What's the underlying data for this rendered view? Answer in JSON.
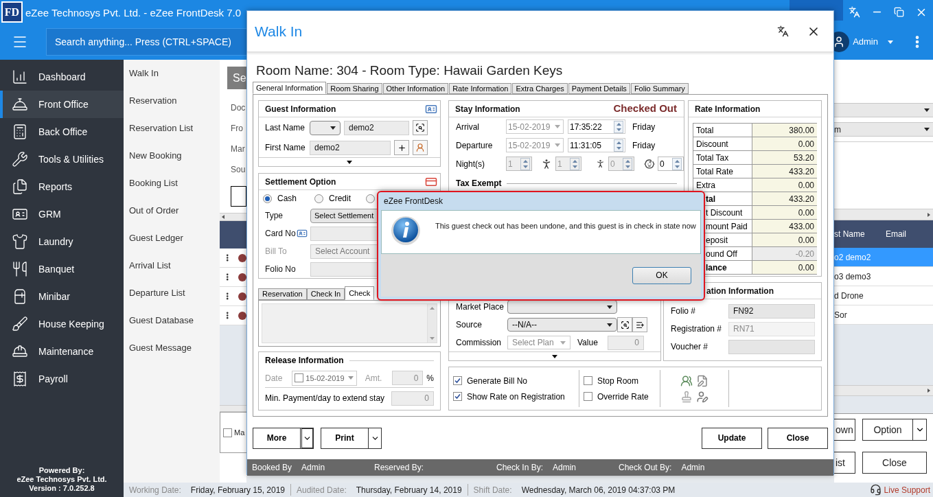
{
  "app": {
    "logo": "FD",
    "title": "eZee Technosys Pvt. Ltd. - eZee FrontDesk 7.0"
  },
  "search": {
    "placeholder": "Search anything... Press (CTRL+SPACE)"
  },
  "user": {
    "name": "Admin"
  },
  "sidebar": {
    "items": [
      {
        "label": "Dashboard",
        "selected": false
      },
      {
        "label": "Front Office",
        "selected": true
      },
      {
        "label": "Back Office",
        "selected": false
      },
      {
        "label": "Tools & Utilities",
        "selected": false
      },
      {
        "label": "Reports",
        "selected": false
      },
      {
        "label": "GRM",
        "selected": false
      },
      {
        "label": "Laundry",
        "selected": false
      },
      {
        "label": "Banquet",
        "selected": false
      },
      {
        "label": "Minibar",
        "selected": false
      },
      {
        "label": "House Keeping",
        "selected": false
      },
      {
        "label": "Maintenance",
        "selected": false
      },
      {
        "label": "Payroll",
        "selected": false
      }
    ],
    "footer": [
      "Powered By:",
      "eZee Technosys Pvt. Ltd.",
      "Version : 7.0.252.8"
    ]
  },
  "submenu": {
    "items": [
      "Walk In",
      "Reservation",
      "Reservation List",
      "New Booking",
      "Booking List",
      "Out of Order",
      "Guest Ledger",
      "Arrival List",
      "Departure List",
      "Guest Database",
      "Guest Message"
    ]
  },
  "background": {
    "left": {
      "button": "Se",
      "labels": [
        "Doc",
        "Fro",
        "Mar",
        "Sou"
      ],
      "checkbox": {
        "label": "Ma",
        "checked": false
      }
    },
    "right": {
      "dropdowns": [
        {
          "kind": "select"
        },
        {
          "kind": "select",
          "value": "m"
        }
      ],
      "columns": [
        "st Name",
        "Email"
      ],
      "rows": [
        {
          "cell": "o2 demo2",
          "selected": true
        },
        {
          "cell": "o3 demo3",
          "selected": false
        },
        {
          "cell": "d Drone",
          "selected": false
        },
        {
          "cell": "Sor",
          "selected": false
        }
      ],
      "button_rows": [
        [
          {
            "label": "own",
            "kind": "plain"
          },
          {
            "label": "Option",
            "kind": "split"
          }
        ],
        [
          {
            "label": "ist",
            "kind": "plain"
          },
          {
            "label": "Close",
            "kind": "plain"
          }
        ]
      ]
    }
  },
  "walk_in": {
    "title": "Walk In",
    "heading": "Room Name: 304 - Room Type: Hawaii Garden Keys",
    "tabs": [
      {
        "label": "General Information",
        "selected": true
      },
      {
        "label": "Room Sharing",
        "selected": false
      },
      {
        "label": "Other Information",
        "selected": false
      },
      {
        "label": "Rate Information",
        "selected": false
      },
      {
        "label": "Extra Charges",
        "selected": false
      },
      {
        "label": "Payment Details",
        "selected": false
      },
      {
        "label": "Folio Summary",
        "selected": false
      }
    ],
    "guest": {
      "title": "Guest Information",
      "last_name_label": "Last Name",
      "last_name": "demo2",
      "first_name_label": "First Name",
      "first_name": "demo2"
    },
    "settlement": {
      "title": "Settlement Option",
      "options": [
        {
          "label": "Cash",
          "selected": true
        },
        {
          "label": "Credit",
          "selected": false
        },
        {
          "selected": false
        }
      ],
      "fields": [
        {
          "label": "Type",
          "kind": "button",
          "value": "Select Settlement",
          "disabled": false
        },
        {
          "label": "Card No",
          "kind": "card",
          "disabled": false
        },
        {
          "label": "Bill To",
          "kind": "select",
          "value": "Select Account",
          "disabled": true
        },
        {
          "label": "Folio No",
          "kind": "text",
          "disabled": false
        }
      ]
    },
    "note_tabs": [
      {
        "label": "Reservation",
        "selected": false
      },
      {
        "label": "Check In",
        "selected": false
      },
      {
        "label": "Check",
        "selected": true
      }
    ],
    "release": {
      "title": "Release Information",
      "date_label": "Date",
      "date_checked": false,
      "date": "15-02-2019",
      "amount_label": "Amt.",
      "amount": "0",
      "percent": "%",
      "min_payment_label": "Min. Payment/day to extend stay",
      "min_payment": "0"
    },
    "stay": {
      "title": "Stay Information",
      "status": "Checked Out",
      "dates": [
        {
          "label": "Arrival",
          "date": "15-02-2019",
          "time": "17:35:22",
          "day": "Friday"
        },
        {
          "label": "Departure",
          "date": "15-02-2019",
          "time": "11:31:05",
          "day": "Friday"
        }
      ],
      "nights_label": "Night(s)",
      "nights": "1",
      "adults": "1",
      "children": "0",
      "infants": "0",
      "tax_exempt": "Tax Exempt",
      "market_place_label": "Market Place",
      "source_label": "Source",
      "source": "--N/A--",
      "commission_label": "Commission",
      "commission": "Select Plan",
      "value_label": "Value",
      "value": "0"
    },
    "rate": {
      "title": "Rate Information",
      "rows": [
        {
          "label": "Total",
          "value": "380.00",
          "bold": false,
          "covered": false,
          "disabled": false
        },
        {
          "label": "Discount",
          "value": "0.00",
          "bold": false,
          "covered": false,
          "disabled": false
        },
        {
          "label": "Total Tax",
          "value": "53.20",
          "bold": false,
          "covered": false,
          "disabled": false
        },
        {
          "label": "Total Rate",
          "value": "433.20",
          "bold": false,
          "covered": false,
          "disabled": false
        },
        {
          "label": "Extra",
          "value": "0.00",
          "bold": false,
          "covered": false,
          "disabled": false
        },
        {
          "label": "tal",
          "value": "433.20",
          "bold": true,
          "covered": true,
          "disabled": false
        },
        {
          "label": "t Discount",
          "value": "0.00",
          "bold": false,
          "covered": true,
          "disabled": false
        },
        {
          "label": "mount Paid",
          "value": "433.00",
          "bold": false,
          "covered": true,
          "disabled": false
        },
        {
          "label": "eposit",
          "value": "0.00",
          "bold": false,
          "covered": true,
          "disabled": false
        },
        {
          "label": "ound Off",
          "value": "-0.20",
          "bold": false,
          "covered": true,
          "disabled": true
        },
        {
          "label": "lance",
          "value": "0.00",
          "bold": true,
          "covered": true,
          "disabled": false
        }
      ]
    },
    "reservation": {
      "title": "ation Information",
      "fields": [
        {
          "label": "Folio #",
          "value": "FN92",
          "disabled": false
        },
        {
          "label": "Registration #",
          "value": "RN71",
          "disabled": true
        },
        {
          "label": "Voucher #",
          "disabled": false
        }
      ]
    },
    "option_groups": [
      [
        {
          "label": "Generate Bill No",
          "checked": true
        },
        {
          "label": "Show Rate on Registration",
          "checked": true
        }
      ],
      [
        {
          "label": "Stop Room",
          "checked": false
        },
        {
          "label": "Override Rate",
          "checked": false
        }
      ]
    ],
    "left_buttons": [
      "More",
      "Print"
    ],
    "right_buttons": [
      "Update",
      "Close"
    ],
    "audit": [
      {
        "label": "Booked By",
        "value": "Admin"
      },
      {
        "label": "Reserved By:"
      },
      {
        "label": "Check In By:",
        "value": "Admin"
      },
      {
        "label": "Check Out By:",
        "value": "Admin"
      }
    ]
  },
  "message_box": {
    "title": "eZee FrontDesk",
    "message": "This guest check out has been undone, and this guest is in check in state now",
    "button": "OK"
  },
  "status_bar": {
    "items": [
      {
        "label": "Working Date:",
        "value": "Friday, February 15, 2019"
      },
      {
        "label": "Audited Date:",
        "value": "Thursday, February 14, 2019"
      },
      {
        "label": "Shift Date:",
        "value": "Wednesday, March 06, 2019 04:37:03 PM"
      }
    ],
    "support": "Live Support"
  }
}
